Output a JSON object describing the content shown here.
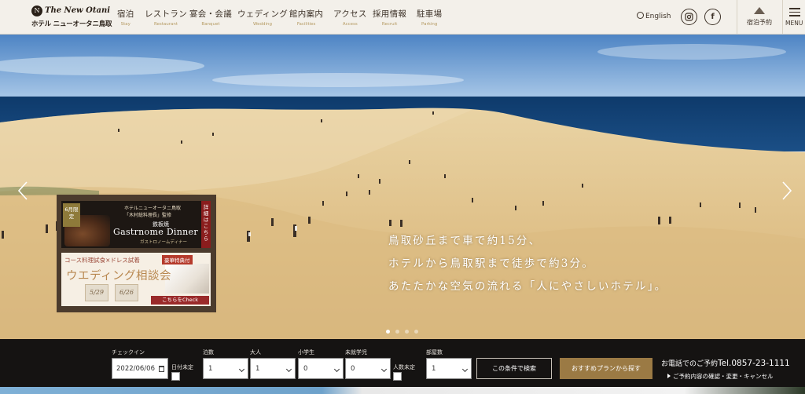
{
  "logo": {
    "script_text": "The New Otani",
    "emblem": "N",
    "jp_text": "ホテル ニューオータニ鳥取",
    "icon": "hotel-emblem-icon"
  },
  "nav": [
    {
      "ja": "宿泊",
      "en": "Stay"
    },
    {
      "ja": "レストラン",
      "en": "Restaurant"
    },
    {
      "ja": "宴会・会議",
      "en": "Banquet"
    },
    {
      "ja": "ウェディング",
      "en": "Wedding"
    },
    {
      "ja": "館内案内",
      "en": "Facilities"
    },
    {
      "ja": "アクセス",
      "en": "Access"
    },
    {
      "ja": "採用情報",
      "en": "Recruit"
    },
    {
      "ja": "駐車場",
      "en": "Parking"
    }
  ],
  "header": {
    "language": "English",
    "instagram_icon": "instagram-icon",
    "facebook_label": "f",
    "reserve_label": "宿泊予約",
    "menu_label": "MENU"
  },
  "hero": {
    "tagline": [
      "鳥取砂丘まで車で約15分、",
      "ホテルから鳥取駅まで徒歩で約3分。",
      "あたたかな空気の流れる「人にやさしいホテル」。"
    ],
    "slide_count": 4,
    "active_slide": 1
  },
  "promo": {
    "banner1": {
      "tag": "6月限定",
      "line1": "ホテルニューオータニ鳥取",
      "line2": "「木村総料理長」監修",
      "line3": "鉄板焼",
      "title": "Gastrnome Dinner",
      "subtitle": "ガストロノームディナー",
      "side": "詳細はこちら"
    },
    "banner2": {
      "line1": "コース料理試食×ドレス試着",
      "badge": "豪華特典付",
      "title": "ウエディング相談会",
      "date1": "5/29",
      "date2": "6/26",
      "cta": "こちらをCheck"
    }
  },
  "booking": {
    "checkin_label": "チェックイン",
    "checkin_value": "2022/06/06",
    "undecided_date": "日付未定",
    "nights_label": "泊数",
    "nights_value": "1",
    "adults_label": "大人",
    "adults_value": "1",
    "elem_label": "小学生",
    "elem_value": "0",
    "preschool_label": "未就学児",
    "preschool_value": "0",
    "undecided_people": "人数未定",
    "rooms_label": "部屋数",
    "rooms_value": "1",
    "search_button": "この条件で検索",
    "plan_button": "おすすめプランから探す",
    "tel_prefix": "お電話でのご予約",
    "tel_number": "Tel.0857-23-1111",
    "confirm_link": "ご予約内容の確認・変更・キャンセル"
  },
  "colors": {
    "header_bg": "#f3f0ea",
    "accent_gold": "#b59a62",
    "booking_bg": "#151312",
    "plan_button": "#9b7a44",
    "sky": "#7aa9d8",
    "sea": "#17406e",
    "sand": "#e2c690"
  }
}
